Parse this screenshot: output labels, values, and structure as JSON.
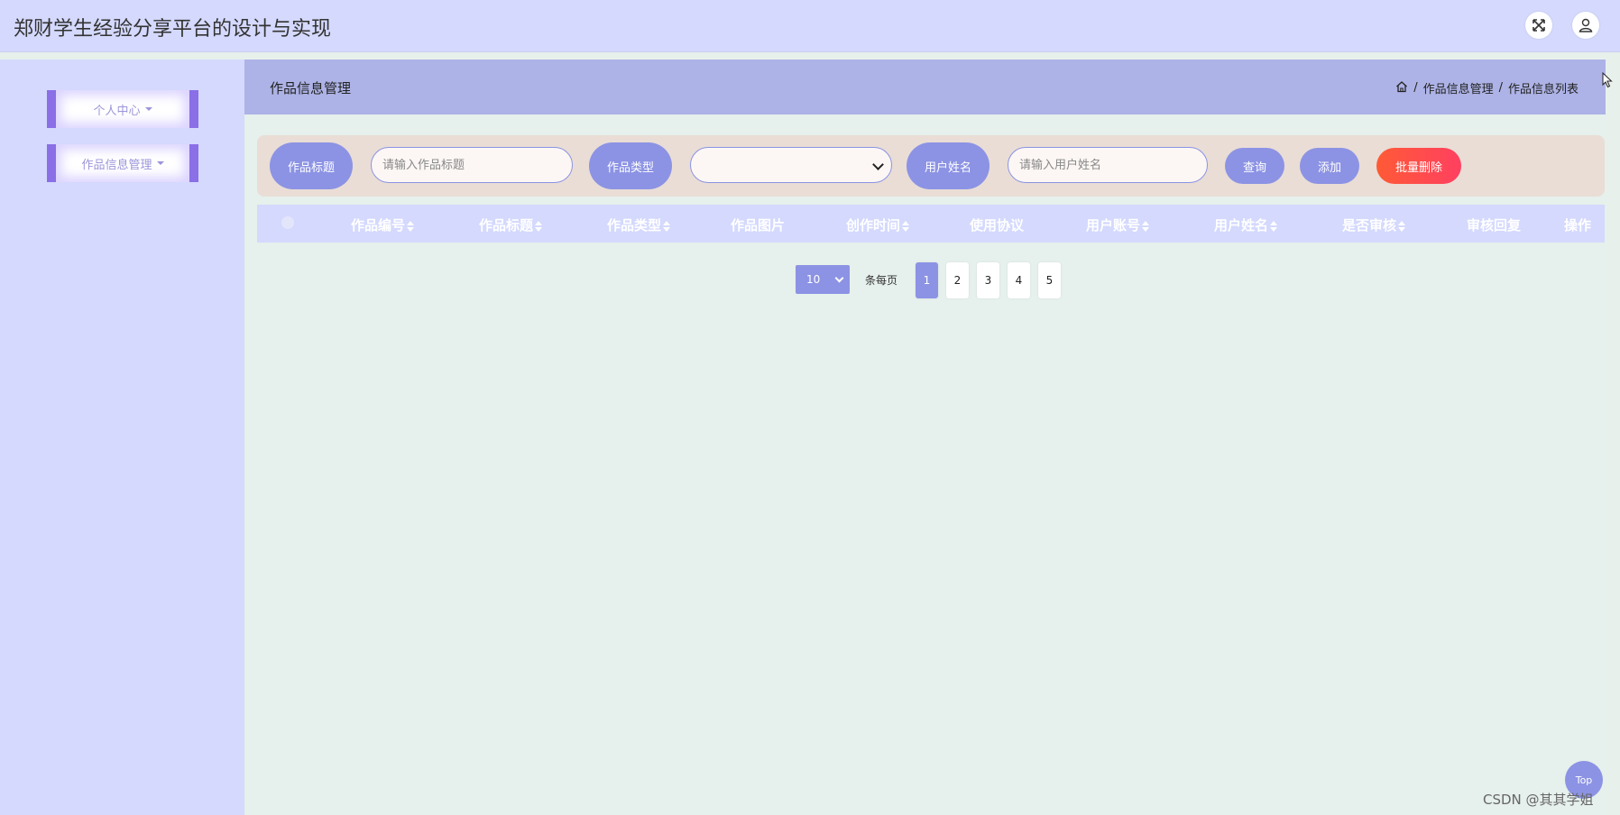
{
  "header": {
    "app_title": "郑财学生经验分享平台的设计与实现",
    "icons": [
      "fullscreen-icon",
      "user-icon"
    ]
  },
  "sidebar": {
    "items": [
      {
        "label": "个人中心"
      },
      {
        "label": "作品信息管理"
      }
    ]
  },
  "page": {
    "title": "作品信息管理",
    "breadcrumb": [
      "作品信息管理",
      "作品信息列表"
    ]
  },
  "search": {
    "title_label": "作品标题",
    "title_placeholder": "请输入作品标题",
    "type_label": "作品类型",
    "type_value": "",
    "username_label": "用户姓名",
    "username_placeholder": "请输入用户姓名",
    "query_label": "查询",
    "add_label": "添加",
    "batch_delete_label": "批量删除"
  },
  "table": {
    "columns": [
      "作品编号",
      "作品标题",
      "作品类型",
      "作品图片",
      "创作时间",
      "使用协议",
      "用户账号",
      "用户姓名",
      "是否审核",
      "审核回复",
      "操作"
    ],
    "rows": []
  },
  "pagination": {
    "page_size": "10",
    "per_page_label": "条每页",
    "pages": [
      "1",
      "2",
      "3",
      "4",
      "5"
    ],
    "current": "1"
  },
  "misc": {
    "top_label": "Top",
    "watermark": "CSDN @其其学姐"
  },
  "colors": {
    "accent": "#8c93e4",
    "header_bg": "#d4d9fd",
    "danger_gradient_start": "#ff5a36",
    "danger_gradient_end": "#ff4060"
  }
}
